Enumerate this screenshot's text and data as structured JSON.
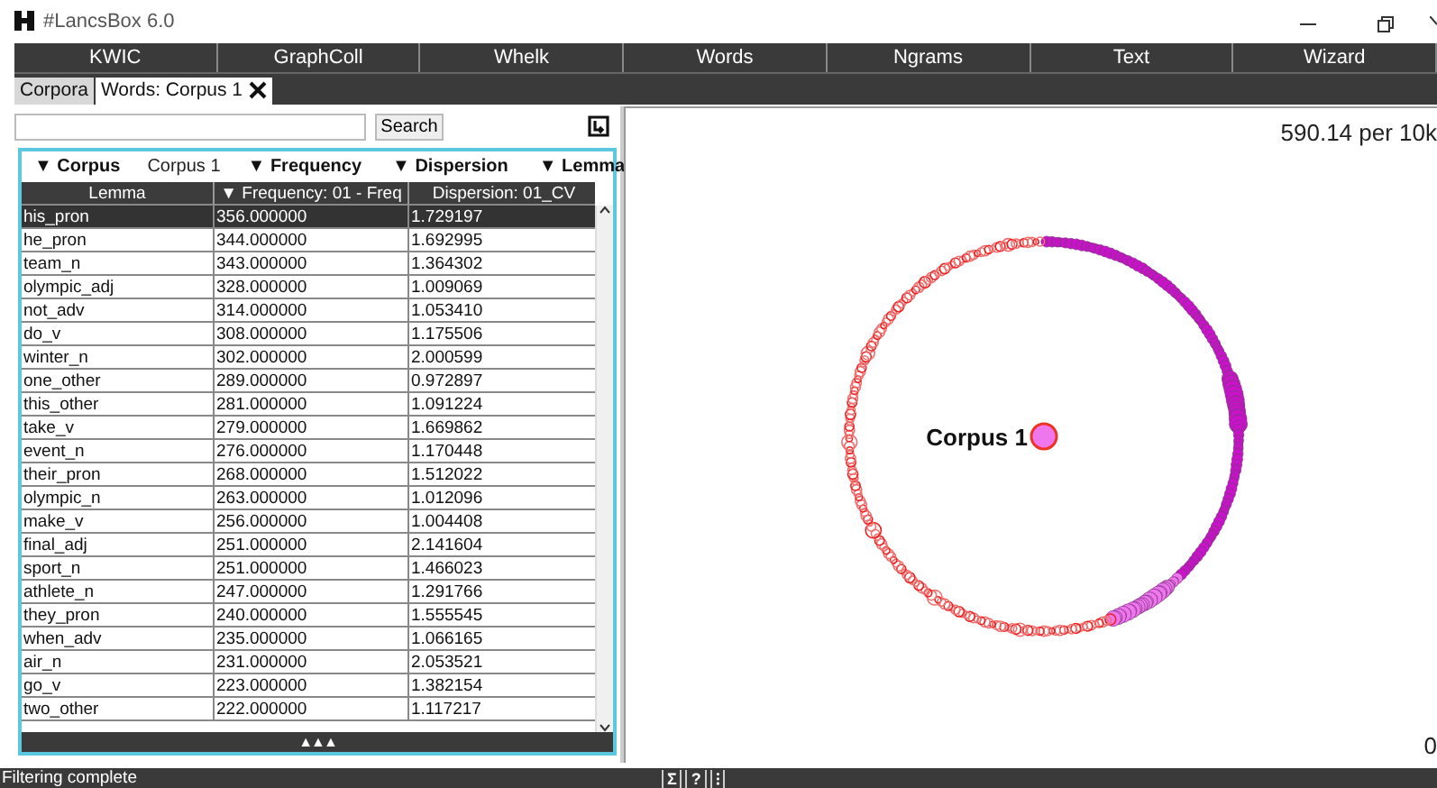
{
  "window": {
    "title": "#LancsBox 6.0"
  },
  "menu": [
    {
      "label": "KWIC"
    },
    {
      "label": "GraphColl"
    },
    {
      "label": "Whelk"
    },
    {
      "label": "Words"
    },
    {
      "label": "Ngrams"
    },
    {
      "label": "Text"
    },
    {
      "label": "Wizard"
    }
  ],
  "tabs": [
    {
      "label": "Corpora",
      "selected": false,
      "closable": false
    },
    {
      "label": "Words: Corpus 1",
      "selected": true,
      "closable": true
    }
  ],
  "search": {
    "button": "Search"
  },
  "filters": [
    {
      "label": "▼ Corpus",
      "value": "Corpus 1"
    },
    {
      "label": "▼ Frequency"
    },
    {
      "label": "▼ Dispersion"
    },
    {
      "label": "▼ Lemma"
    }
  ],
  "table": {
    "columns": [
      "Lemma",
      "▼ Frequency: 01 - Freq",
      "Dispersion: 01_CV"
    ],
    "rows": [
      {
        "cells": [
          "his_pron",
          "356.000000",
          "1.729197"
        ],
        "selected": true
      },
      {
        "cells": [
          "he_pron",
          "344.000000",
          "1.692995"
        ],
        "selected": false
      },
      {
        "cells": [
          "team_n",
          "343.000000",
          "1.364302"
        ],
        "selected": false
      },
      {
        "cells": [
          "olympic_adj",
          "328.000000",
          "1.009069"
        ],
        "selected": false
      },
      {
        "cells": [
          "not_adv",
          "314.000000",
          "1.053410"
        ],
        "selected": false
      },
      {
        "cells": [
          "do_v",
          "308.000000",
          "1.175506"
        ],
        "selected": false
      },
      {
        "cells": [
          "winter_n",
          "302.000000",
          "2.000599"
        ],
        "selected": false
      },
      {
        "cells": [
          "one_other",
          "289.000000",
          "0.972897"
        ],
        "selected": false
      },
      {
        "cells": [
          "this_other",
          "281.000000",
          "1.091224"
        ],
        "selected": false
      },
      {
        "cells": [
          "take_v",
          "279.000000",
          "1.669862"
        ],
        "selected": false
      },
      {
        "cells": [
          "event_n",
          "276.000000",
          "1.170448"
        ],
        "selected": false
      },
      {
        "cells": [
          "their_pron",
          "268.000000",
          "1.512022"
        ],
        "selected": false
      },
      {
        "cells": [
          "olympic_n",
          "263.000000",
          "1.012096"
        ],
        "selected": false
      },
      {
        "cells": [
          "make_v",
          "256.000000",
          "1.004408"
        ],
        "selected": false
      },
      {
        "cells": [
          "final_adj",
          "251.000000",
          "2.141604"
        ],
        "selected": false
      },
      {
        "cells": [
          "sport_n",
          "251.000000",
          "1.466023"
        ],
        "selected": false
      },
      {
        "cells": [
          "athlete_n",
          "247.000000",
          "1.291766"
        ],
        "selected": false
      },
      {
        "cells": [
          "they_pron",
          "240.000000",
          "1.555545"
        ],
        "selected": false
      },
      {
        "cells": [
          "when_adv",
          "235.000000",
          "1.066165"
        ],
        "selected": false
      },
      {
        "cells": [
          "air_n",
          "231.000000",
          "2.053521"
        ],
        "selected": false
      },
      {
        "cells": [
          "go_v",
          "223.000000",
          "1.382154"
        ],
        "selected": false
      },
      {
        "cells": [
          "two_other",
          "222.000000",
          "1.117217"
        ],
        "selected": false
      }
    ]
  },
  "expand": "▲▲▲",
  "graph": {
    "rate": "590.14 per 10k",
    "node": "Corpus 1",
    "scale": "0"
  },
  "status_bar": {
    "text": "Filtering complete",
    "tools": [
      "Σ",
      "?",
      "⁝"
    ]
  }
}
